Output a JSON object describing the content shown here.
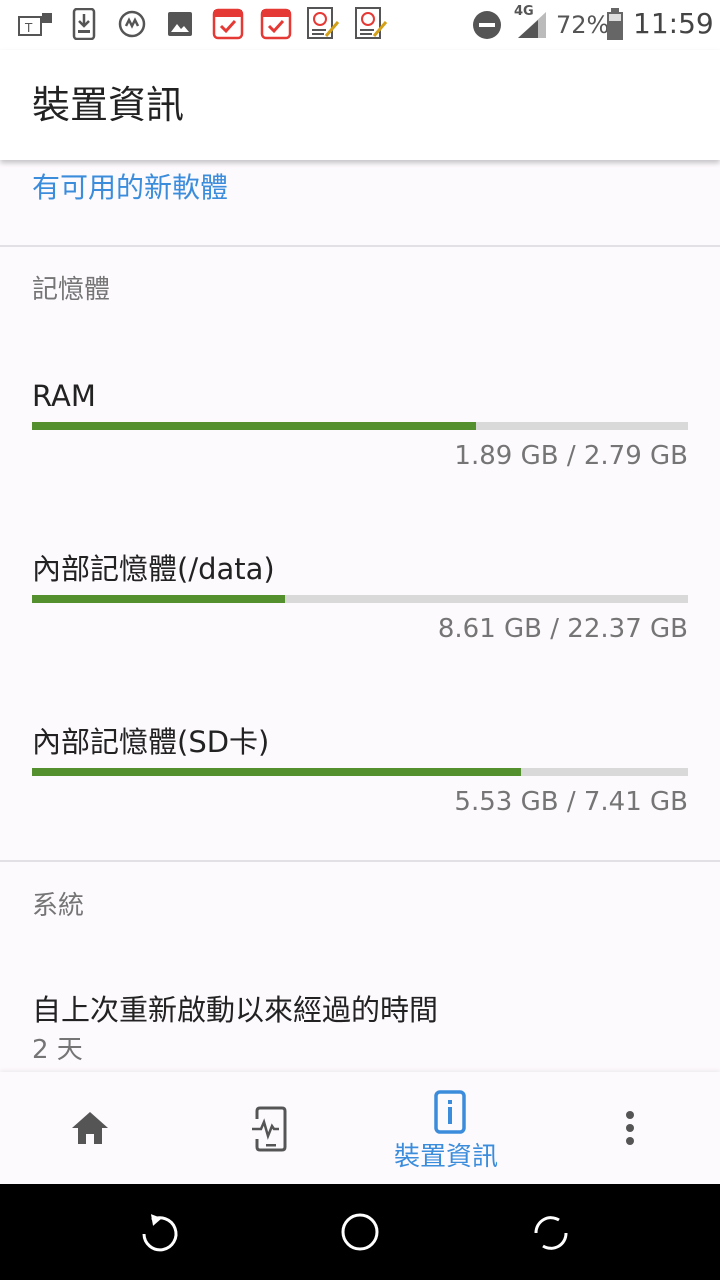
{
  "status_bar": {
    "icons": [
      "sim-icon",
      "download-icon",
      "sync-icon",
      "image-icon",
      "calendar-icon",
      "calendar-icon",
      "checklist-icon",
      "checklist-icon",
      "do-not-disturb-icon",
      "signal-icon",
      "battery-icon"
    ],
    "network": "4G",
    "battery": "72%",
    "time": "11:59"
  },
  "app_bar": {
    "title": "裝置資訊"
  },
  "software": {
    "update_link": "有可用的新軟體"
  },
  "memory": {
    "section_title": "記憶體",
    "items": [
      {
        "label": "RAM",
        "value": "1.89 GB / 2.79 GB",
        "used_fraction": 0.677
      },
      {
        "label": "內部記憶體(/data)",
        "value": "8.61 GB / 22.37 GB",
        "used_fraction": 0.385
      },
      {
        "label": "內部記憶體(SD卡)",
        "value": "5.53 GB / 7.41 GB",
        "used_fraction": 0.746
      }
    ]
  },
  "system": {
    "section_title": "系統",
    "uptime_label": "自上次重新啟動以來經過的時間",
    "uptime_value": "2 天"
  },
  "bottom_nav": {
    "items": [
      {
        "icon": "home-icon",
        "label": ""
      },
      {
        "icon": "device-health-icon",
        "label": ""
      },
      {
        "icon": "device-info-icon",
        "label": "裝置資訊",
        "active": true
      },
      {
        "icon": "more-vert-icon",
        "label": ""
      }
    ]
  },
  "colors": {
    "accent": "#3b8ddc",
    "bar_fill": "#55902e",
    "bar_track": "#d9d9d9"
  }
}
